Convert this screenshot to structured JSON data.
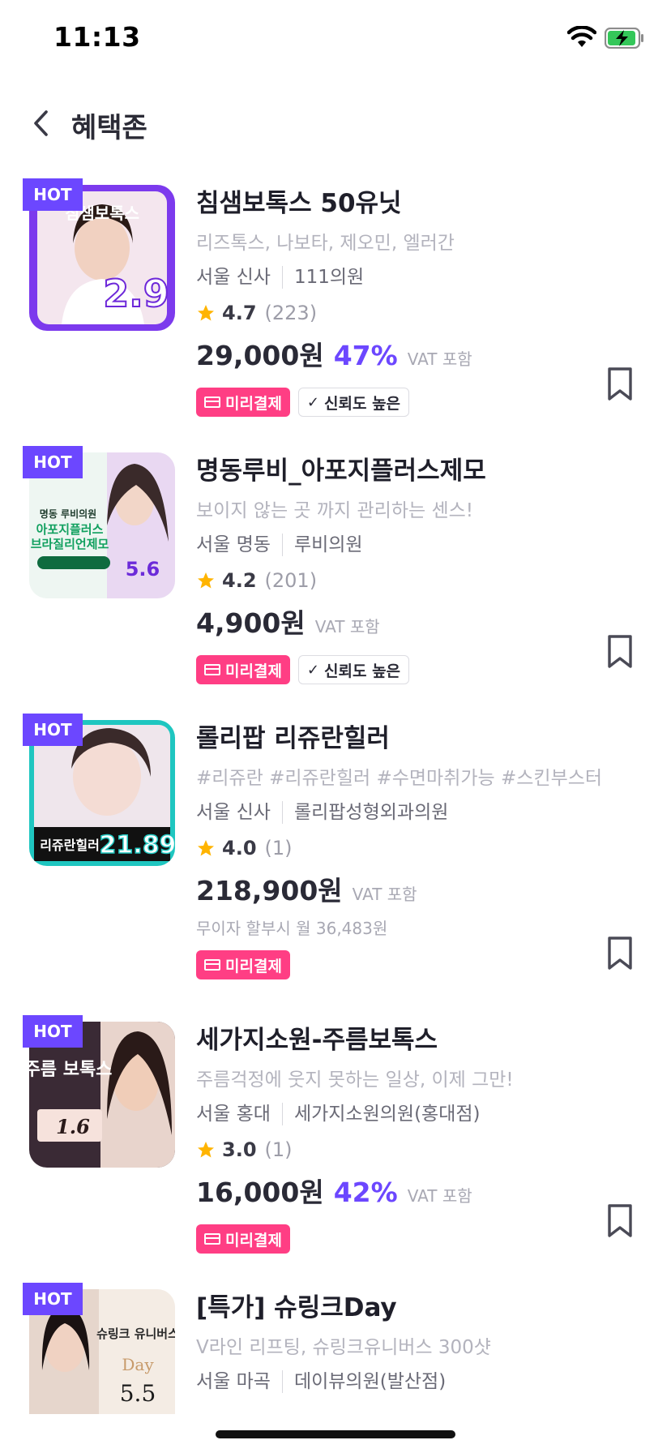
{
  "status_bar": {
    "time": "11:13"
  },
  "header": {
    "title": "혜택존"
  },
  "colors": {
    "accent": "#6c47ff",
    "prepay": "#ff3e84",
    "star": "#ffb400"
  },
  "items": [
    {
      "hot": "HOT",
      "title": "침샘보톡스 50유닛",
      "subtitle": "리즈톡스, 나보타, 제오민, 엘러간",
      "region": "서울 신사",
      "clinic": "111의원",
      "rating": "4.7",
      "review_count": "(223)",
      "price": "29,000원",
      "discount": "47%",
      "vat": "VAT 포함",
      "tag_prepay": "미리결제",
      "tag_trust": "신뢰도 높은",
      "thumb": {
        "text1": "침샘보톡스",
        "text2": "2.9",
        "bg": "#7c3aed"
      }
    },
    {
      "hot": "HOT",
      "title": "명동루비_아포지플러스제모",
      "subtitle": "보이지 않는 곳 까지 관리하는 센스!",
      "region": "서울 명동",
      "clinic": "루비의원",
      "rating": "4.2",
      "review_count": "(201)",
      "price": "4,900원",
      "discount": "",
      "vat": "VAT 포함",
      "tag_prepay": "미리결제",
      "tag_trust": "신뢰도 높은",
      "thumb": {
        "text1": "명동 루비의원",
        "text2": "5.6",
        "bg": "#e8f4ef"
      }
    },
    {
      "hot": "HOT",
      "title": "롤리팝 리쥬란힐러",
      "subtitle": "#리쥬란 #리쥬란힐러 #수면마취가능 #스킨부스터",
      "region": "서울 신사",
      "clinic": "롤리팝성형외과의원",
      "rating": "4.0",
      "review_count": "(1)",
      "price": "218,900원",
      "discount": "",
      "vat": "VAT 포함",
      "installment": "무이자 할부시 월 36,483원",
      "tag_prepay": "미리결제",
      "thumb": {
        "text1": "리쥬란힐러",
        "text2": "21.89",
        "bg": "#1fc6c0"
      }
    },
    {
      "hot": "HOT",
      "title": "세가지소원-주름보톡스",
      "subtitle": "주름걱정에 웃지 못하는 일상, 이제 그만!",
      "region": "서울 홍대",
      "clinic": "세가지소원의원(홍대점)",
      "rating": "3.0",
      "review_count": "(1)",
      "price": "16,000원",
      "discount": "42%",
      "vat": "VAT 포함",
      "tag_prepay": "미리결제",
      "thumb": {
        "text1": "주름 보톡스",
        "text2": "1.6",
        "bg": "#3a2a35"
      }
    },
    {
      "hot": "HOT",
      "title": "[특가] 슈링크Day",
      "subtitle": "V라인 리프팅,  슈링크유니버스 300샷",
      "region": "서울 마곡",
      "clinic": "데이뷰의원(발산점)",
      "thumb": {
        "text1": "슈링크 유니버스",
        "text2": "Day",
        "text3": "5.5",
        "bg": "#f4ece4"
      }
    }
  ]
}
